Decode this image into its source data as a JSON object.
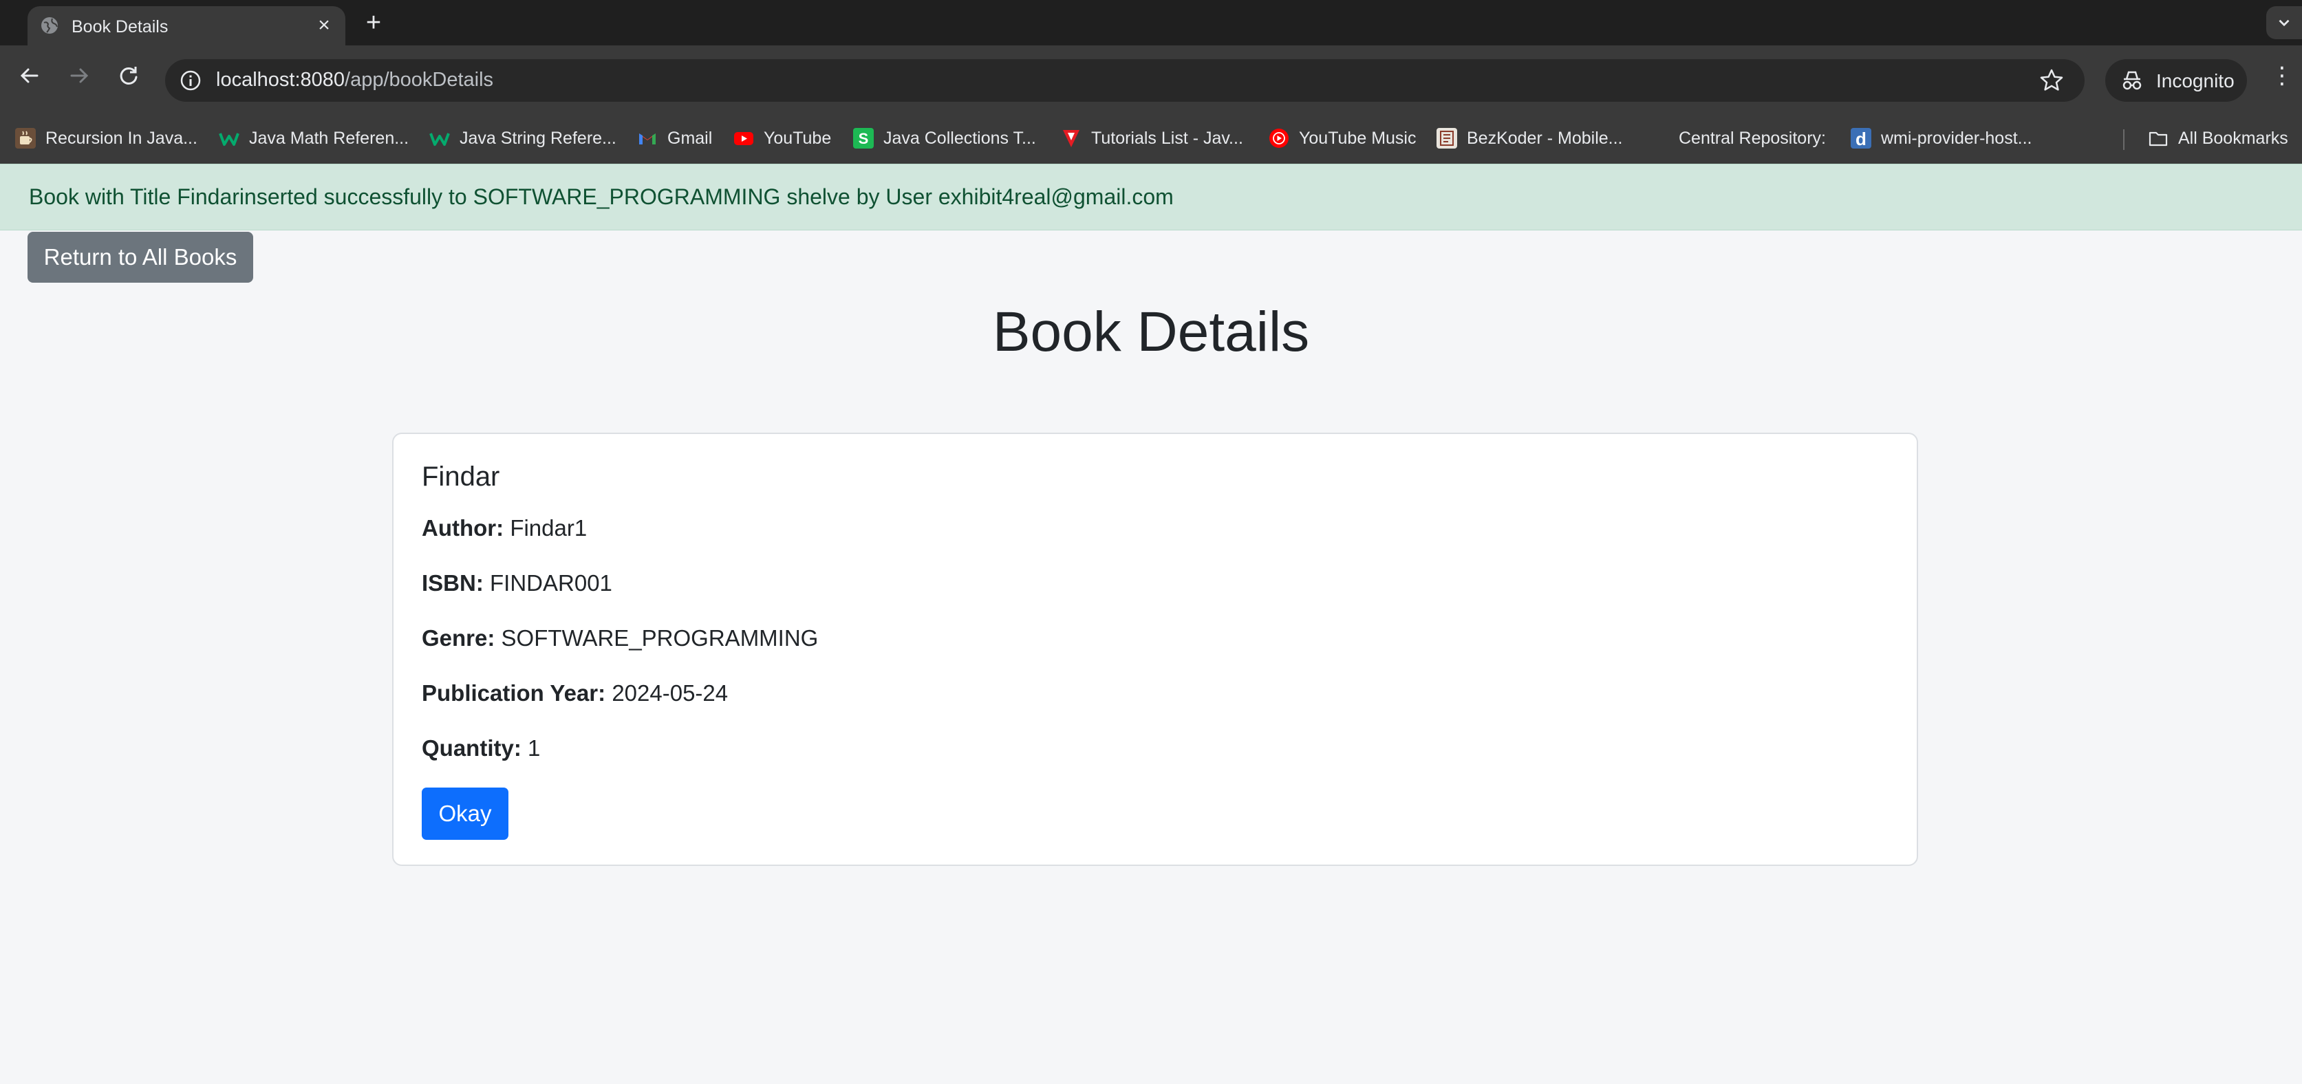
{
  "browser": {
    "tab_title": "Book Details",
    "new_tab_symbol": "+",
    "url_host": "localhost:8080",
    "url_path": "/app/bookDetails",
    "incognito_label": "Incognito",
    "bookmarks": [
      {
        "label": "Recursion In Java...",
        "icon": "java-cup-favicon"
      },
      {
        "label": "Java Math Referen...",
        "icon": "w3schools-favicon"
      },
      {
        "label": "Java String Refere...",
        "icon": "w3schools-favicon"
      },
      {
        "label": "Gmail",
        "icon": "gmail-favicon"
      },
      {
        "label": "YouTube",
        "icon": "youtube-favicon"
      },
      {
        "label": "Java Collections T...",
        "icon": "s-favicon"
      },
      {
        "label": "Tutorials List - Jav...",
        "icon": "javatpoint-favicon"
      },
      {
        "label": "YouTube Music",
        "icon": "youtube-music-favicon"
      },
      {
        "label": "BezKoder - Mobile...",
        "icon": "bezkoder-favicon"
      },
      {
        "label": "Central Repository:",
        "icon": ""
      },
      {
        "label": "wmi-provider-host...",
        "icon": "d-favicon"
      }
    ],
    "all_bookmarks_label": "All Bookmarks"
  },
  "alert": {
    "message": "Book with Title Findarinserted successfully to SOFTWARE_PROGRAMMING shelve by User exhibit4real@gmail.com"
  },
  "page": {
    "return_button_label": "Return to All Books",
    "title": "Book Details"
  },
  "book": {
    "title": "Findar",
    "author_label": "Author:",
    "author": "Findar1",
    "isbn_label": "ISBN:",
    "isbn": "FINDAR001",
    "genre_label": "Genre:",
    "genre": "SOFTWARE_PROGRAMMING",
    "year_label": "Publication Year:",
    "year": "2024-05-24",
    "quantity_label": "Quantity:",
    "quantity": "1",
    "okay_label": "Okay"
  },
  "colors": {
    "alert_bg": "#d1e7dd",
    "alert_text": "#0f5132",
    "secondary_button": "#6c757d",
    "primary_button": "#0d6efd"
  }
}
